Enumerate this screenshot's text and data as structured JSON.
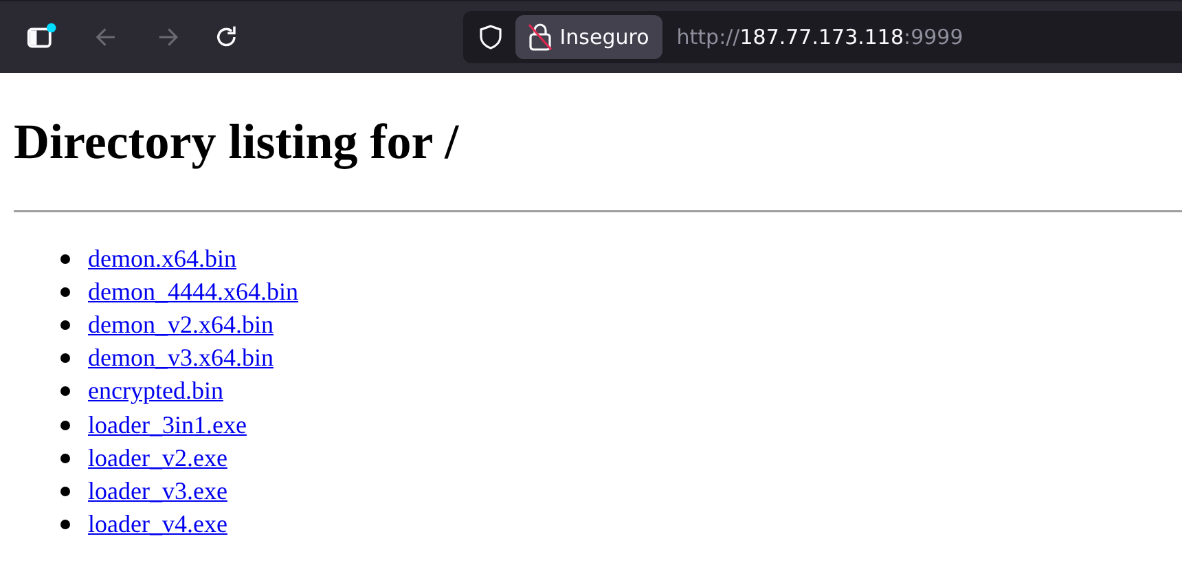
{
  "browser": {
    "tracking_badge": true,
    "back_disabled": true,
    "forward_disabled": true,
    "security_label": "Inseguro",
    "url": {
      "scheme": "http://",
      "host": "187.77.173.118",
      "port": ":9999"
    }
  },
  "page": {
    "title": "Directory listing for /",
    "files": [
      {
        "name": "demon.x64.bin"
      },
      {
        "name": "demon_4444.x64.bin"
      },
      {
        "name": "demon_v2.x64.bin"
      },
      {
        "name": "demon_v3.x64.bin"
      },
      {
        "name": "encrypted.bin"
      },
      {
        "name": "loader_3in1.exe"
      },
      {
        "name": "loader_v2.exe"
      },
      {
        "name": "loader_v3.exe"
      },
      {
        "name": "loader_v4.exe"
      }
    ]
  }
}
